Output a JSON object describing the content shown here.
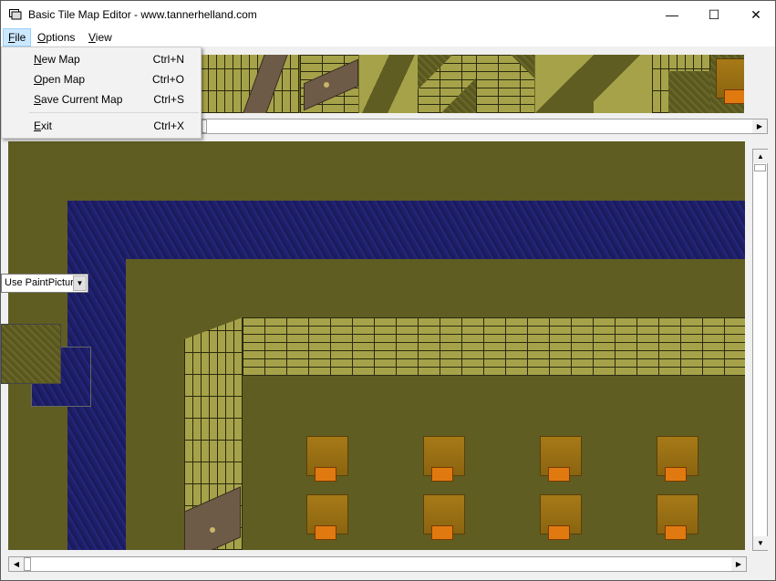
{
  "window": {
    "title": "Basic Tile Map Editor - www.tannerhelland.com",
    "controls": {
      "minimize": "—",
      "maximize": "☐",
      "close": "✕"
    }
  },
  "menubar": {
    "items": [
      {
        "label": "File",
        "mnemonic": "F",
        "rest": "ile"
      },
      {
        "label": "Options",
        "mnemonic": "O",
        "rest": "ptions"
      },
      {
        "label": "View",
        "mnemonic": "V",
        "rest": "iew"
      }
    ]
  },
  "file_menu": {
    "items": [
      {
        "mnemonic": "N",
        "rest": "ew Map",
        "shortcut": "Ctrl+N"
      },
      {
        "mnemonic": "O",
        "rest": "pen Map",
        "shortcut": "Ctrl+O"
      },
      {
        "mnemonic": "S",
        "rest": "ave Current Map",
        "shortcut": "Ctrl+S"
      },
      {
        "mnemonic": "E",
        "rest": "xit",
        "shortcut": "Ctrl+X"
      }
    ]
  },
  "render_mode": {
    "selected": "Use PaintPicture"
  },
  "scroll_arrows": {
    "left": "◀",
    "right": "▶",
    "up": "▲",
    "down": "▼",
    "dropdown": "▼"
  },
  "colors": {
    "grass": "#5f5d22",
    "water": "#1f2068",
    "brick": "#a6a24a",
    "crate": "#a77a17",
    "menu_highlight": "#cce8ff"
  }
}
